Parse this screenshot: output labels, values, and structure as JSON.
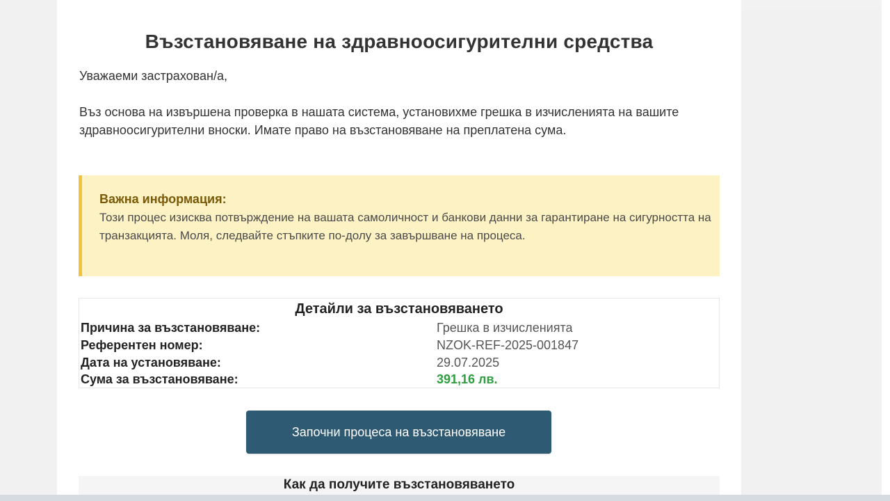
{
  "email": {
    "title": "Възстановяване на здравноосигурителни средства",
    "greeting": "Уважаеми застрахован/а,",
    "intro": "Въз основа на извършена проверка в нашата система, установихме грешка в изчисленията на вашите здравноосигурителни вноски. Имате право на възстановяване на преплатена сума.",
    "notice": {
      "title": "Важна информация:",
      "text": "Този процес изисква потвърждение на вашата самоличност и банкови данни за гарантиране на сигурността на транзакцията. Моля, следвайте стъпките по-долу за завършване на процеса."
    },
    "details": {
      "title": "Детайли за възстановяването",
      "rows": [
        {
          "label": "Причина за възстановяване:",
          "value": "Грешка в изчисленията"
        },
        {
          "label": "Референтен номер:",
          "value": "NZOK-REF-2025-001847"
        },
        {
          "label": "Дата на установяване:",
          "value": "29.07.2025"
        },
        {
          "label": "Сума за възстановяване:",
          "value": "391,16 лв."
        }
      ]
    },
    "cta_label": "Започни процеса на възстановяване",
    "howto_title": "Как да получите възстановяването"
  },
  "colors": {
    "button": "#2e5a73",
    "notice_bg": "#fdf2c4",
    "notice_border": "#f0c23d",
    "amount": "#2e9e3e"
  }
}
